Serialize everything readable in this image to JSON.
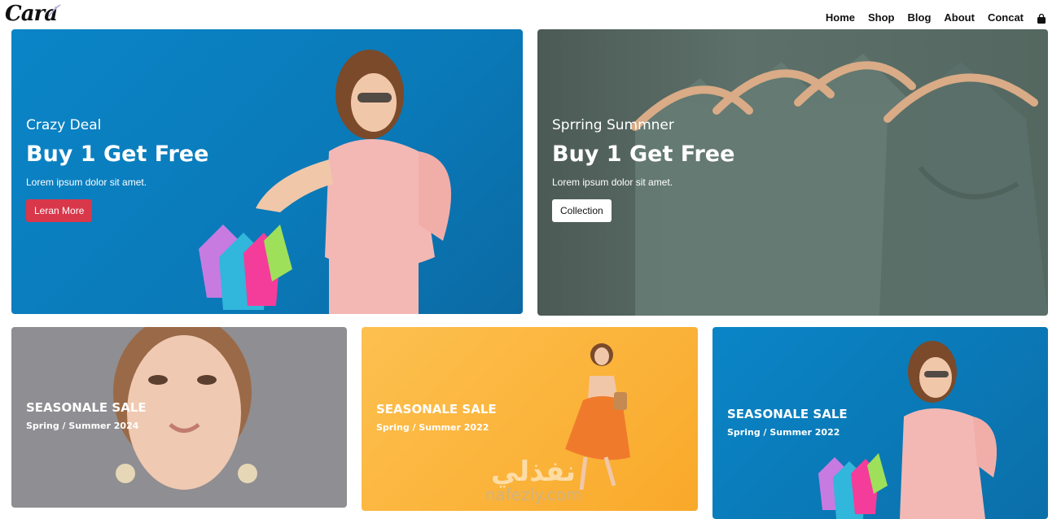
{
  "header": {
    "logo": "Cara",
    "nav": [
      "Home",
      "Shop",
      "Blog",
      "About",
      "Concat"
    ],
    "bag_icon": "shopping-bag-icon"
  },
  "hero_left": {
    "eyebrow": "Crazy Deal",
    "title": "Buy 1 Get Free",
    "desc": "Lorem ipsum dolor sit amet.",
    "button": "Leran More",
    "colors": {
      "bg": "#0a85c7",
      "button": "#d9374a"
    }
  },
  "hero_right": {
    "eyebrow": "Sprring Summner",
    "title": "Buy 1 Get Free",
    "desc": "Lorem ipsum dolor sit amet.",
    "button": "Collection",
    "colors": {
      "bg": "#5d706a"
    }
  },
  "promos": [
    {
      "title": "SEASONALE SALE",
      "sub": "Spring / Summer 2024",
      "bg": "#8f8e92"
    },
    {
      "title": "SEASONALE SALE",
      "sub": "Spring / Summer 2022",
      "bg": "#fbb53a"
    },
    {
      "title": "SEASONALE SALE",
      "sub": "Spring / Summer 2022",
      "bg": "#0a85c7"
    }
  ],
  "watermark": {
    "arabic": "نفذلي",
    "latin": "nafezly.com"
  }
}
